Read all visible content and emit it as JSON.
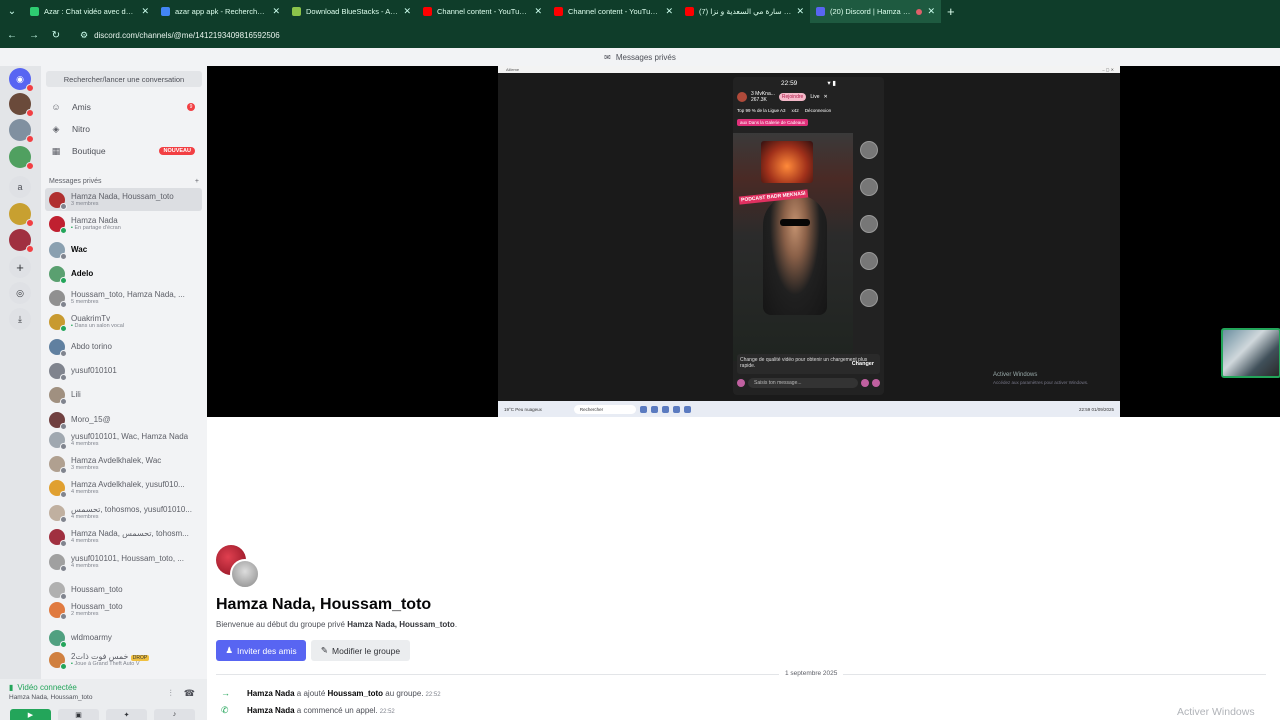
{
  "browser": {
    "tabs": [
      {
        "title": "Azar : Chat vidéo avec de nouv",
        "color": "#2ecc71",
        "active": false
      },
      {
        "title": "azar app apk - Recherche Goog",
        "color": "#4285f4",
        "active": false
      },
      {
        "title": "Download BlueStacks - App Pla",
        "color": "#8bc34a",
        "active": false
      },
      {
        "title": "Channel content - YouTube Stu",
        "color": "#ff0000",
        "active": false
      },
      {
        "title": "Channel content - YouTube Stu",
        "color": "#ff0000",
        "active": false
      },
      {
        "title": "نايضة سارة مي السعدية و نزا (7)",
        "color": "#ff0000",
        "active": false
      },
      {
        "title": "(20) Discord | Hamza Nada",
        "color": "#5865f2",
        "active": true
      }
    ],
    "url": "discord.com/channels/@me/1412193409816592506"
  },
  "discord": {
    "window_title": "Messages privés",
    "search_placeholder": "Rechercher/lancer une conversation",
    "nav": [
      {
        "label": "Amis",
        "icon": "friends-icon"
      },
      {
        "label": "Nitro",
        "icon": "nitro-icon"
      },
      {
        "label": "Boutique",
        "icon": "shop-icon",
        "badge": "NOUVEAU"
      }
    ],
    "friends_badge": "9",
    "dm_header": "Messages privés",
    "dm_add": "+",
    "dms": [
      {
        "name": "Hamza Nada, Houssam_toto",
        "sub": "3 membres",
        "bold": false,
        "selected": true,
        "color": "#b03030",
        "online": false
      },
      {
        "name": "Hamza Nada",
        "sub": "En partage d'écran",
        "bold": false,
        "selected": false,
        "color": "#c02030",
        "online": true,
        "sub_green": true
      },
      {
        "name": "Wac",
        "sub": "",
        "bold": true,
        "selected": false,
        "color": "#8aa0b0",
        "online": false
      },
      {
        "name": "Adelo",
        "sub": "",
        "bold": true,
        "selected": false,
        "color": "#5aa070",
        "online": true
      },
      {
        "name": "Houssam_toto, Hamza Nada, ...",
        "sub": "5 membres",
        "bold": false,
        "selected": false,
        "color": "#909090",
        "online": false
      },
      {
        "name": "OuakrimTv",
        "sub": "Dans un salon vocal",
        "bold": false,
        "selected": false,
        "color": "#c89a30",
        "online": true,
        "sub_green": true
      },
      {
        "name": "Abdo torino",
        "sub": "",
        "bold": false,
        "selected": false,
        "color": "#6080a0",
        "online": false
      },
      {
        "name": "yusuf010101",
        "sub": "",
        "bold": false,
        "selected": false,
        "color": "#80848e",
        "online": false
      },
      {
        "name": "Lili",
        "sub": "",
        "bold": false,
        "selected": false,
        "color": "#a09080",
        "online": false
      },
      {
        "name": "Moro_15@",
        "sub": "",
        "bold": false,
        "selected": false,
        "color": "#704040",
        "online": false
      },
      {
        "name": "yusuf010101, Wac, Hamza Nada",
        "sub": "4 membres",
        "bold": false,
        "selected": false,
        "color": "#a0a8b0",
        "online": false
      },
      {
        "name": "Hamza Avdelkhalek, Wac",
        "sub": "3 membres",
        "bold": false,
        "selected": false,
        "color": "#b0a090",
        "online": false
      },
      {
        "name": "Hamza Avdelkhalek, yusuf010...",
        "sub": "4 membres",
        "bold": false,
        "selected": false,
        "color": "#e0a030",
        "online": false
      },
      {
        "name": "تحسمس, tohosmos, yusuf01010...",
        "sub": "4 membres",
        "bold": false,
        "selected": false,
        "color": "#c0b0a0",
        "online": false
      },
      {
        "name": "Hamza Nada, تحسمس, tohosm...",
        "sub": "4 membres",
        "bold": false,
        "selected": false,
        "color": "#a03040",
        "online": false
      },
      {
        "name": "yusuf010101, Houssam_toto, ...",
        "sub": "4 membres",
        "bold": false,
        "selected": false,
        "color": "#a0a0a0",
        "online": false
      },
      {
        "name": "Houssam_toto",
        "sub": "",
        "bold": false,
        "selected": false,
        "color": "#b0b0b0",
        "online": false
      },
      {
        "name": "Houssam_toto",
        "sub": "2 membres",
        "bold": false,
        "selected": false,
        "color": "#e07a40",
        "online": false
      },
      {
        "name": "wldmoarmy",
        "sub": "",
        "bold": false,
        "selected": false,
        "color": "#50a080",
        "online": true
      },
      {
        "name": "2خمس فوت ذات",
        "sub": "Joue à Grand Theft Auto V",
        "bold": false,
        "selected": false,
        "color": "#d08040",
        "online": true,
        "sub_green": true,
        "tag": "DROP"
      }
    ],
    "voice": {
      "title": "Vidéo connectée",
      "channel": "Hamza Nada, Houssam_toto"
    }
  },
  "stream": {
    "screen_title": "Ailleme",
    "phone": {
      "time": "22:59",
      "streamer": "3 MvKna...",
      "streamer_sub": "267.3K",
      "pk_label": "Rejoindre",
      "viewer_count": "Live",
      "rank": "Top 99 % de la Ligue A3",
      "likes": "x42",
      "disconnect": "Déconnexion",
      "gift_banner": "aux Dans la Galerie de Cadeaux",
      "podcast": "PODCAST BADR MEKNASI",
      "notice": "Change de qualité vidéo pour obtenir un chargement plus rapide.",
      "notice_action": "Changer",
      "input_placeholder": "Saisis ton message..."
    },
    "taskbar": {
      "weather": "19°C Peu nuageux",
      "search": "Rechercher",
      "time": "22:59",
      "date": "01/09/2025"
    },
    "activate_small_title": "Activer Windows",
    "activate_small_sub": "Accédez aux paramètres pour activer Windows."
  },
  "chat": {
    "group_title": "Hamza Nada, Houssam_toto",
    "welcome_prefix": "Bienvenue au début du groupe privé ",
    "welcome_names": "Hamza Nada, Houssam_toto",
    "welcome_suffix": ".",
    "invite_label": "Inviter des amis",
    "edit_label": "Modifier le groupe",
    "date_separator": "1 septembre 2025",
    "events": [
      {
        "actor": "Hamza Nada",
        "text": " a ajouté ",
        "target": "Houssam_toto",
        "text2": " au groupe.",
        "time": "22:52",
        "icon": "→"
      },
      {
        "actor": "Hamza Nada",
        "text": " a commencé un appel.",
        "target": "",
        "text2": "",
        "time": "22:52",
        "icon": "✆"
      }
    ]
  },
  "watermark": "Activer Windows"
}
